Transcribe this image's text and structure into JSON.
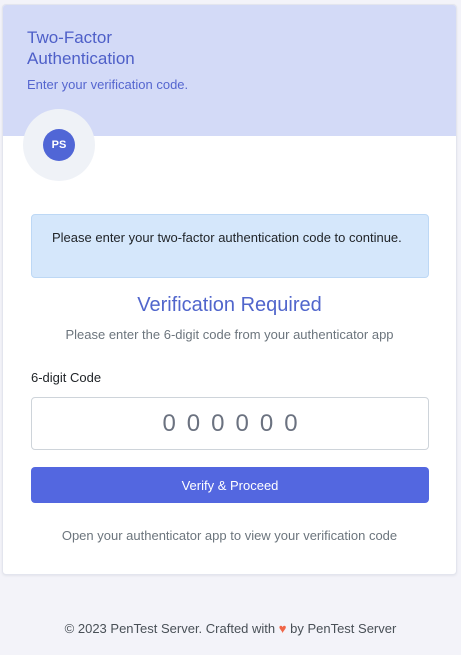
{
  "header": {
    "title": "Two-Factor Authentication",
    "subtitle": "Enter your verification code."
  },
  "avatar": {
    "initials": "PS"
  },
  "alert": {
    "message": "Please enter your two-factor authentication code to continue."
  },
  "verification": {
    "title": "Verification Required",
    "subtitle": "Please enter the 6-digit code from your authenticator app"
  },
  "form": {
    "code_label": "6-digit Code",
    "code_placeholder": "000000",
    "code_value": "",
    "submit_label": "Verify & Proceed"
  },
  "help_text": "Open your authenticator app to view your verification code",
  "footer": {
    "prefix": "© 2023 PenTest Server. Crafted with",
    "heart": "♥",
    "suffix": "by PenTest Server"
  },
  "colors": {
    "header_bg": "#d3daf7",
    "primary": "#5367e0",
    "alert_bg": "#d5e7fb",
    "heart": "#f06548"
  }
}
